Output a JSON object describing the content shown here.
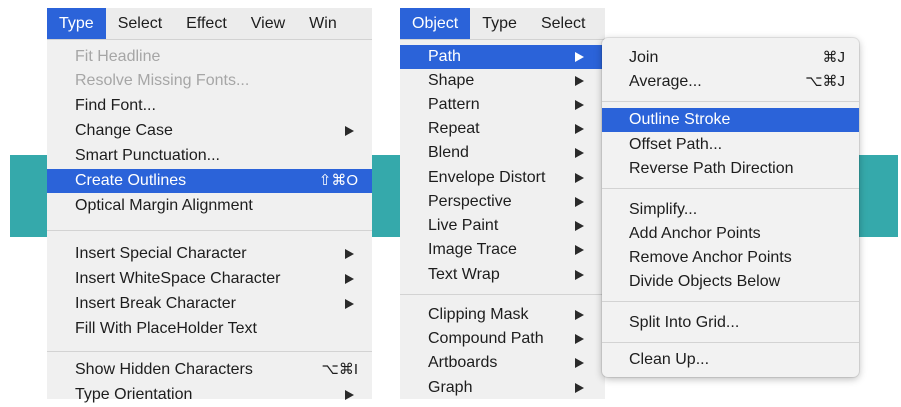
{
  "colors": {
    "accent": "#2b63d9",
    "teal": "#35a9ab",
    "menu_bg": "#f0f0f0"
  },
  "left_panel": {
    "menubar": [
      "Type",
      "Select",
      "Effect",
      "View",
      "Win"
    ],
    "items": [
      {
        "label": "Fit Headline",
        "disabled": true
      },
      {
        "label": "Resolve Missing Fonts...",
        "disabled": true
      },
      {
        "label": "Find Font..."
      },
      {
        "label": "Change Case",
        "submenu": true
      },
      {
        "label": "Smart Punctuation..."
      },
      {
        "label": "Create Outlines",
        "shortcut": "⇧⌘O",
        "highlighted": true
      },
      {
        "label": "Optical Margin Alignment"
      },
      {
        "label": "Insert Special Character",
        "submenu": true
      },
      {
        "label": "Insert WhiteSpace Character",
        "submenu": true
      },
      {
        "label": "Insert Break Character",
        "submenu": true
      },
      {
        "label": "Fill With PlaceHolder Text"
      },
      {
        "label": "Show Hidden Characters",
        "shortcut": "⌥⌘I"
      },
      {
        "label": "Type Orientation",
        "submenu": true
      }
    ]
  },
  "right_panel": {
    "menubar": [
      "Object",
      "Type",
      "Select"
    ],
    "items": [
      {
        "label": "Path",
        "submenu": true,
        "highlighted": true
      },
      {
        "label": "Shape",
        "submenu": true
      },
      {
        "label": "Pattern",
        "submenu": true
      },
      {
        "label": "Repeat",
        "submenu": true
      },
      {
        "label": "Blend",
        "submenu": true
      },
      {
        "label": "Envelope Distort",
        "submenu": true
      },
      {
        "label": "Perspective",
        "submenu": true
      },
      {
        "label": "Live Paint",
        "submenu": true
      },
      {
        "label": "Image Trace",
        "submenu": true
      },
      {
        "label": "Text Wrap",
        "submenu": true
      },
      {
        "label": "Clipping Mask",
        "submenu": true
      },
      {
        "label": "Compound Path",
        "submenu": true
      },
      {
        "label": "Artboards",
        "submenu": true
      },
      {
        "label": "Graph",
        "submenu": true
      }
    ]
  },
  "path_submenu": {
    "items": [
      {
        "label": "Join",
        "shortcut": "⌘J"
      },
      {
        "label": "Average...",
        "shortcut": "⌥⌘J"
      },
      {
        "label": "Outline Stroke",
        "highlighted": true
      },
      {
        "label": "Offset Path..."
      },
      {
        "label": "Reverse Path Direction"
      },
      {
        "label": "Simplify..."
      },
      {
        "label": "Add Anchor Points"
      },
      {
        "label": "Remove Anchor Points"
      },
      {
        "label": "Divide Objects Below"
      },
      {
        "label": "Split Into Grid..."
      },
      {
        "label": "Clean Up..."
      }
    ]
  }
}
